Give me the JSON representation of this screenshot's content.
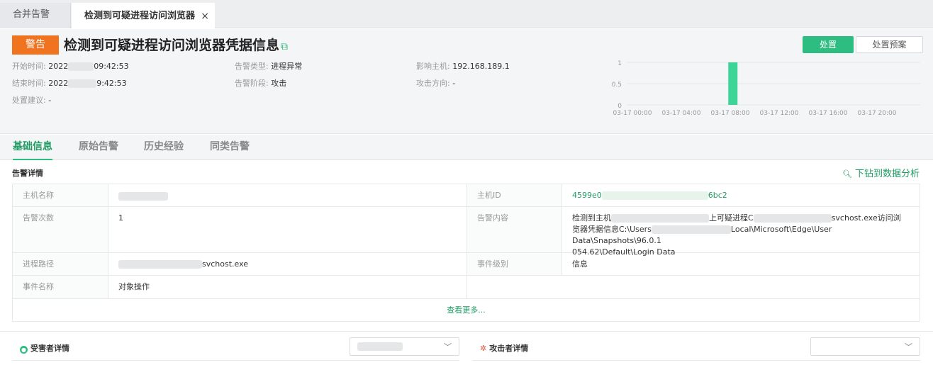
{
  "tabs": [
    {
      "label": "合并告警"
    },
    {
      "label": "检测到可疑进程访问浏览器",
      "close": "×"
    }
  ],
  "header": {
    "badge": "警告",
    "title": "检测到可疑进程访问浏览器凭据信息",
    "title_icon": "external-link-icon",
    "actions": {
      "primary": "处置",
      "secondary": "处置预案"
    },
    "fields": {
      "start_label": "开始时间:",
      "start_prefix": "2022",
      "start_suffix": "09:42:53",
      "end_label": "结束时间:",
      "end_prefix": "2022",
      "end_suffix": "9:42:53",
      "advice_label": "处置建议:",
      "advice_value": "-",
      "type_label": "告警类型:",
      "type_value": "进程异常",
      "stage_label": "告警阶段:",
      "stage_value": "攻击",
      "host_label": "影响主机:",
      "host_value": "192.168.189.1",
      "direction_label": "攻击方向:",
      "direction_value": "-"
    }
  },
  "chart_data": {
    "type": "bar",
    "x": [
      "03-17 00:00",
      "03-17 04:00",
      "03-17 08:00",
      "03-17 12:00",
      "03-17 16:00",
      "03-17 20:00"
    ],
    "yticks": [
      "1",
      "0.5",
      "0"
    ],
    "ylim": [
      0,
      1
    ],
    "bars": [
      {
        "x_hours": 9,
        "value": 1
      }
    ],
    "x_range_hours": [
      0,
      24
    ],
    "color": "#3dd497",
    "grid": true
  },
  "subtabs": [
    "基础信息",
    "原始告警",
    "历史经验",
    "同类告警"
  ],
  "details": {
    "title": "告警详情",
    "drill": "下钻到数据分析",
    "rows": [
      {
        "l1": "主机名称",
        "v1": "",
        "l2": "主机ID",
        "v2a": "4599e0",
        "v2b": "6bc2"
      },
      {
        "l1": "告警次数",
        "v1": "1",
        "l2": "告警内容",
        "v2_line1a": "检测到主机",
        "v2_line1b": "上可疑进程C",
        "v2_line1c": "svchost.exe访问浏",
        "v2_line2a": "览器凭据信息C:\\Users",
        "v2_line2b": "Local\\Microsoft\\Edge\\User Data\\Snapshots\\96.0.1",
        "v2_line3": "054.62\\Default\\Login Data"
      },
      {
        "l1": "进程路径",
        "v1": "svchost.exe",
        "l2": "事件级别",
        "v2": "信息"
      },
      {
        "l1": "事件名称",
        "v1": "对象操作"
      }
    ],
    "more": "查看更多..."
  },
  "bottom": {
    "victim": "受害者详情",
    "attacker": "攻击者详情"
  }
}
